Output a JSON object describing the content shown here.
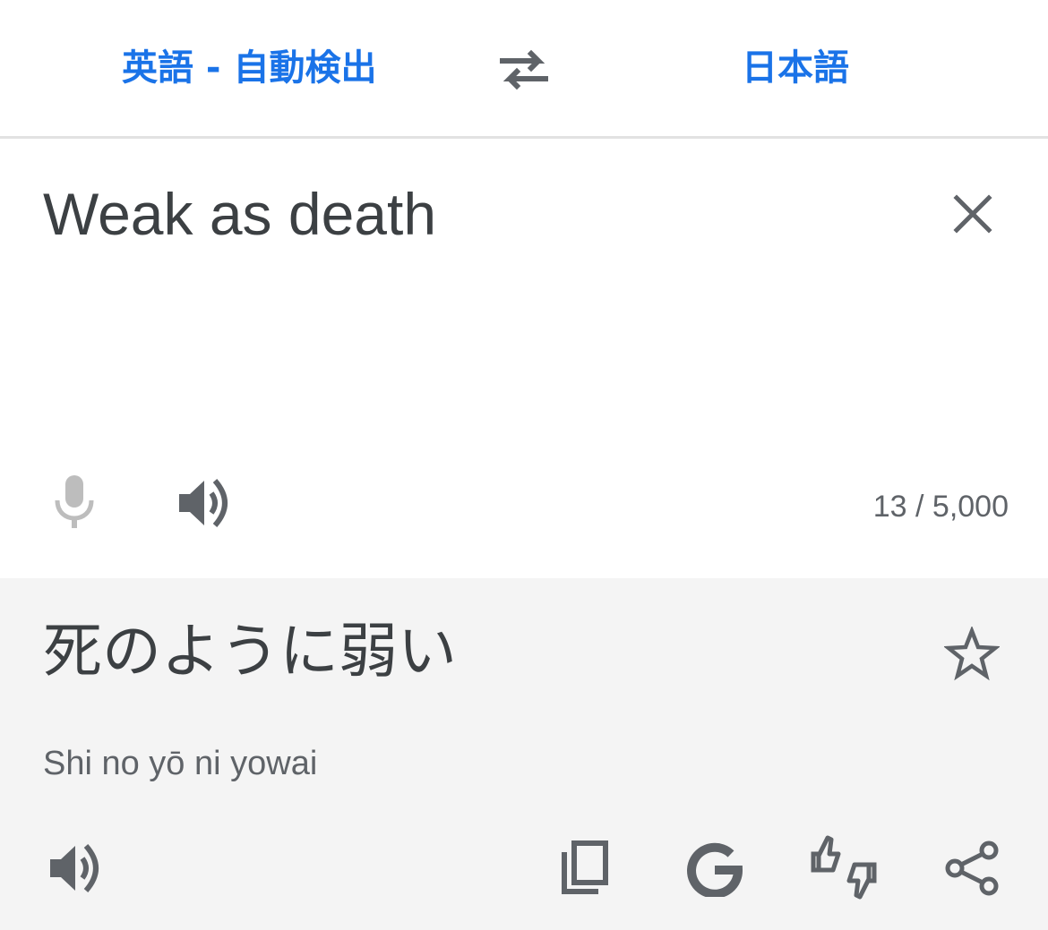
{
  "language_bar": {
    "source_language": "英語 - 自動検出",
    "target_language": "日本語"
  },
  "input": {
    "text": "Weak as death",
    "char_count": "13 / 5,000"
  },
  "result": {
    "translation": "死のように弱い",
    "romanization": "Shi no yō ni yowai"
  },
  "colors": {
    "accent": "#1a73e8",
    "text": "#3c4043",
    "secondary": "#5f6368",
    "result_bg": "#f4f4f4"
  },
  "icons": {
    "swap": "swap-icon",
    "clear": "close-icon",
    "mic": "mic-icon",
    "speaker": "speaker-icon",
    "star": "star-icon",
    "copy": "copy-icon",
    "google": "google-icon",
    "feedback": "feedback-icon",
    "share": "share-icon"
  }
}
